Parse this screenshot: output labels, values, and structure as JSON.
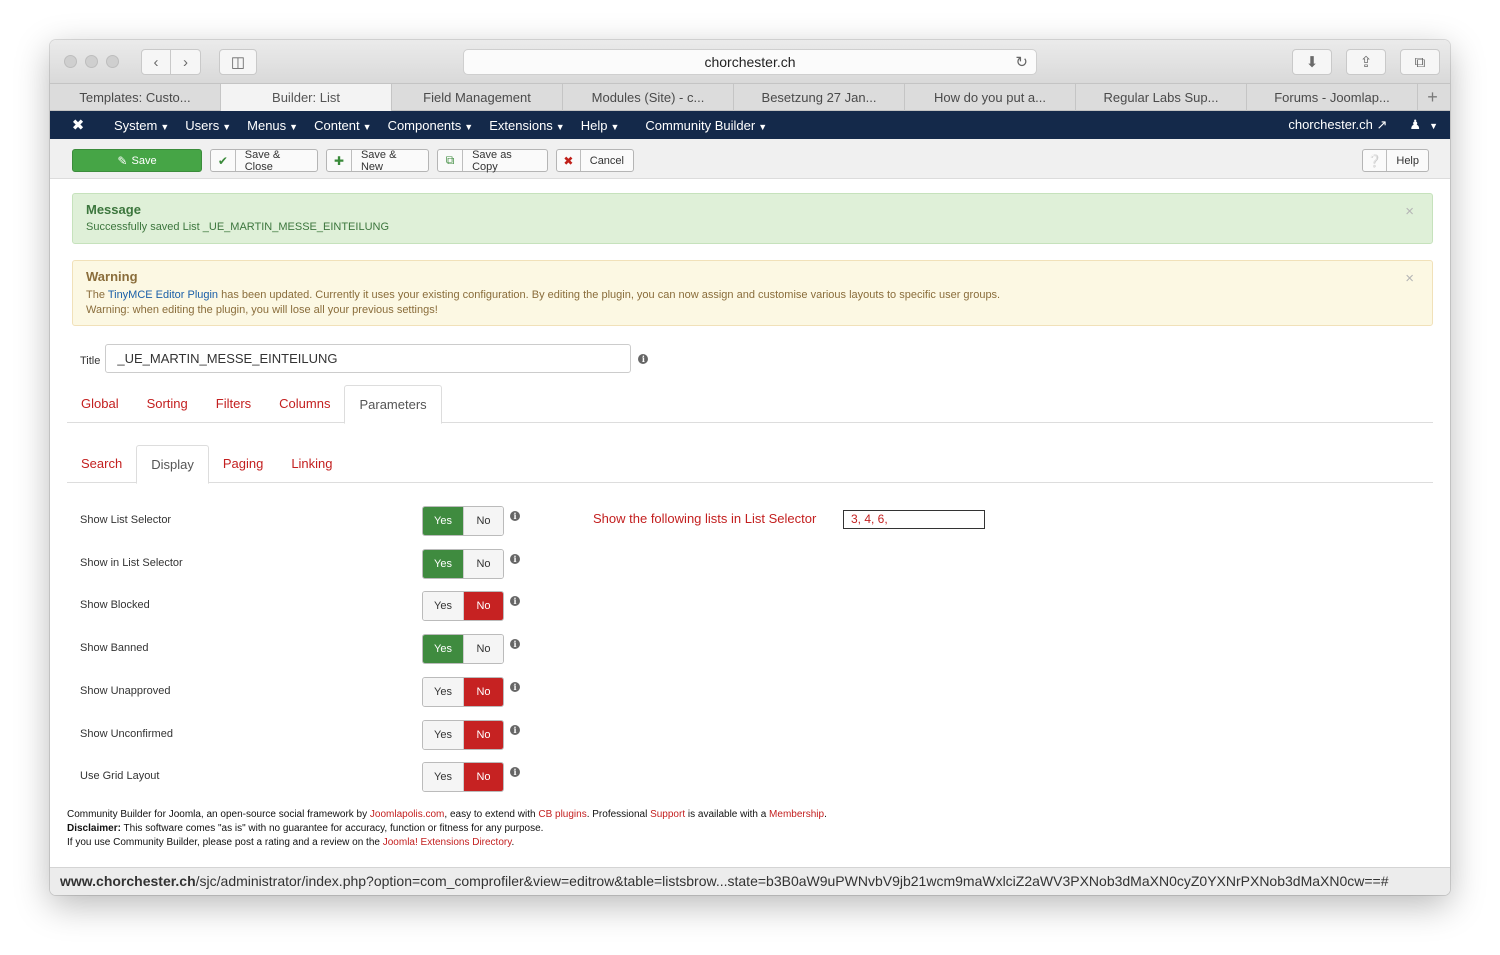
{
  "browser": {
    "url_host": "chorchester.ch",
    "tabs": [
      "Templates: Custo...",
      "Builder: List",
      "Field Management",
      "Modules (Site) - c...",
      "Besetzung 27 Jan...",
      "How do you put a...",
      "Regular Labs Sup...",
      "Forums - Joomlap..."
    ],
    "active_tab": 1,
    "new_tab": "+"
  },
  "jnav": {
    "menus": [
      "System",
      "Users",
      "Menus",
      "Content",
      "Components",
      "Extensions",
      "Help",
      "Community Builder"
    ],
    "site_link": "chorchester.ch"
  },
  "toolbar": {
    "save": "Save",
    "save_close": "Save & Close",
    "save_new": "Save & New",
    "save_copy": "Save as Copy",
    "cancel": "Cancel",
    "help": "Help"
  },
  "message": {
    "heading": "Message",
    "text": "Successfully saved List _UE_MARTIN_MESSE_EINTEILUNG"
  },
  "warning": {
    "heading": "Warning",
    "pre": "The ",
    "link": "TinyMCE Editor Plugin",
    "post": " has been updated. Currently it uses your existing configuration. By editing the plugin, you can now assign and customise various layouts to specific user groups.",
    "line2": "Warning: when editing the plugin, you will lose all your previous settings!"
  },
  "title_field": {
    "label": "Title",
    "value": "_UE_MARTIN_MESSE_EINTEILUNG"
  },
  "main_tabs": [
    "Global",
    "Sorting",
    "Filters",
    "Columns",
    "Parameters"
  ],
  "sub_tabs": [
    "Search",
    "Display",
    "Paging",
    "Linking"
  ],
  "toggle_labels": {
    "yes": "Yes",
    "no": "No"
  },
  "params": [
    {
      "label": "Show List Selector",
      "value": "Yes"
    },
    {
      "label": "Show in List Selector",
      "value": "Yes"
    },
    {
      "label": "Show Blocked",
      "value": "No"
    },
    {
      "label": "Show Banned",
      "value": "Yes"
    },
    {
      "label": "Show Unapproved",
      "value": "No"
    },
    {
      "label": "Show Unconfirmed",
      "value": "No"
    },
    {
      "label": "Use Grid Layout",
      "value": "No"
    }
  ],
  "list_selector": {
    "label": "Show the following lists in List Selector",
    "value": "3, 4, 6,"
  },
  "footer": {
    "l1_a": "Community Builder for Joomla, an open-source social framework by ",
    "l1_link1": "Joomlapolis.com",
    "l1_b": ", easy to extend with ",
    "l1_link2": "CB plugins",
    "l1_c": ". Professional ",
    "l1_link3": "Support",
    "l1_d": " is available with a ",
    "l1_link4": "Membership",
    "l1_e": ".",
    "l2_bold": "Disclaimer:",
    "l2_text": " This software comes \"as is\" with no guarantee for accuracy, function or fitness for any purpose.",
    "l3_text": "If you use Community Builder, please post a rating and a review on the ",
    "l3_link": "Joomla! Extensions Directory",
    "l3_end": "."
  },
  "status": {
    "host": "www.chorchester.ch",
    "path": "/sjc/administrator/index.php?option=com_comprofiler&view=editrow&table=listsbrow...state=b3B0aW9uPWNvbV9jb21wcm9maWxlciZ2aWV3PXNob3dMaXN0cyZ0YXNrPXNob3dMaXN0cw==#"
  },
  "colors": {
    "nav": "#14294a",
    "save": "#46a546",
    "link_red": "#c31f1f",
    "yes_on": "#3f8b3f",
    "no_on": "#c62222"
  }
}
